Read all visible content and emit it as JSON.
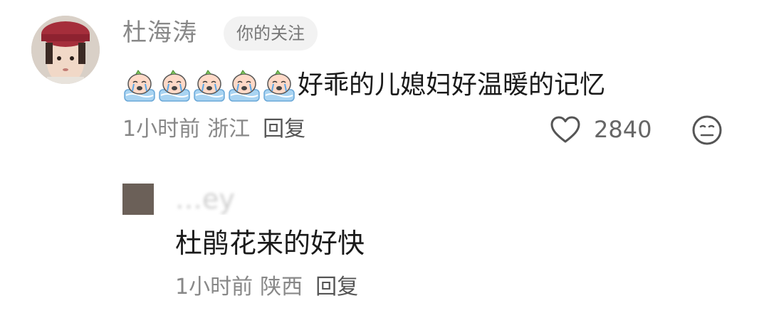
{
  "comment": {
    "username": "杜海涛",
    "follow_badge": "你的关注",
    "emoji_name": "crying-cat-emoji",
    "emoji_count": 5,
    "text": "好乖的儿媳妇好温暖的记忆",
    "time": "1小时前",
    "location": "浙江",
    "reply_label": "回复",
    "like_count": "2840"
  },
  "reply": {
    "username": "…ey",
    "text": "杜鹃花来的好快",
    "time": "1小时前",
    "location": "陕西",
    "reply_label": "回复"
  },
  "colors": {
    "text_primary": "#1a1a1a",
    "text_secondary": "#888888",
    "badge_bg": "#f2f2f2"
  }
}
